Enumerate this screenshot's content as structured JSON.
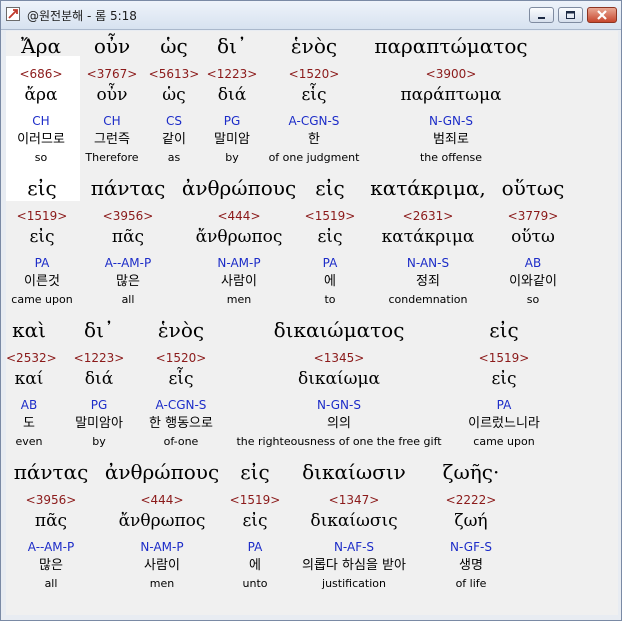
{
  "window": {
    "title": "@원전분해 - 롬 5:18"
  },
  "colors": {
    "strong_number": "#8b1a1a",
    "parsing": "#1c2cc8",
    "text": "#000000",
    "background": "#f0f0f0"
  },
  "rows": [
    {
      "words": [
        {
          "greek": "Ἄρα",
          "strong": "<686>",
          "lemma": "ἄρα",
          "parsing": "CH",
          "korean": "이러므로",
          "english": "so"
        },
        {
          "greek": "οὖν",
          "strong": "<3767>",
          "lemma": "οὖν",
          "parsing": "CH",
          "korean": "그런즉",
          "english": "Therefore"
        },
        {
          "greek": "ὡς",
          "strong": "<5613>",
          "lemma": "ὡς",
          "parsing": "CS",
          "korean": "같이",
          "english": "as"
        },
        {
          "greek": "δι᾽",
          "strong": "<1223>",
          "lemma": "διά",
          "parsing": "PG",
          "korean": "말미암",
          "english": "by"
        },
        {
          "greek": "ἑνὸς",
          "strong": "<1520>",
          "lemma": "εἷς",
          "parsing": "A-CGN-S",
          "korean": "한",
          "english": "of one judgment"
        },
        {
          "greek": "παραπτώματος",
          "strong": "<3900>",
          "lemma": "παράπτωμα",
          "parsing": "N-GN-S",
          "korean": "범죄로",
          "english": "the offense"
        }
      ]
    },
    {
      "words": [
        {
          "greek": "εἰς",
          "strong": "<1519>",
          "lemma": "εἰς",
          "parsing": "PA",
          "korean": "이른것",
          "english": "came upon"
        },
        {
          "greek": "πάντας",
          "strong": "<3956>",
          "lemma": "πᾶς",
          "parsing": "A--AM-P",
          "korean": "많은",
          "english": "all"
        },
        {
          "greek": "ἀνθρώπους",
          "strong": "<444>",
          "lemma": "ἄνθρωπος",
          "parsing": "N-AM-P",
          "korean": "사람이",
          "english": "men"
        },
        {
          "greek": "εἰς",
          "strong": "<1519>",
          "lemma": "εἰς",
          "parsing": "PA",
          "korean": "에",
          "english": "to"
        },
        {
          "greek": "κατάκριμα,",
          "strong": "<2631>",
          "lemma": "κατάκριμα",
          "parsing": "N-AN-S",
          "korean": "정죄",
          "english": "condemnation"
        },
        {
          "greek": "οὕτως",
          "strong": "<3779>",
          "lemma": "οὕτω",
          "parsing": "AB",
          "korean": "이와같이",
          "english": "so"
        }
      ]
    },
    {
      "words": [
        {
          "greek": "καὶ",
          "strong": "<2532>",
          "lemma": "καί",
          "parsing": "AB",
          "korean": "도",
          "english": "even"
        },
        {
          "greek": "δι᾽",
          "strong": "<1223>",
          "lemma": "διά",
          "parsing": "PG",
          "korean": "말미암아",
          "english": "by"
        },
        {
          "greek": "ἑνὸς",
          "strong": "<1520>",
          "lemma": "εἷς",
          "parsing": "A-CGN-S",
          "korean": "한 행동으로",
          "english": "of-one"
        },
        {
          "greek": "δικαιώματος",
          "strong": "<1345>",
          "lemma": "δικαίωμα",
          "parsing": "N-GN-S",
          "korean": "의의",
          "english": "the righteousness of one the free gift"
        },
        {
          "greek": "εἰς",
          "strong": "<1519>",
          "lemma": "εἰς",
          "parsing": "PA",
          "korean": "이르렀느니라",
          "english": "came upon"
        }
      ]
    },
    {
      "words": [
        {
          "greek": "πάντας",
          "strong": "<3956>",
          "lemma": "πᾶς",
          "parsing": "A--AM-P",
          "korean": "많은",
          "english": "all"
        },
        {
          "greek": "ἀνθρώπους",
          "strong": "<444>",
          "lemma": "ἄνθρωπος",
          "parsing": "N-AM-P",
          "korean": "사람이",
          "english": "men"
        },
        {
          "greek": "εἰς",
          "strong": "<1519>",
          "lemma": "εἰς",
          "parsing": "PA",
          "korean": "에",
          "english": "unto"
        },
        {
          "greek": "δικαίωσιν",
          "strong": "<1347>",
          "lemma": "δικαίωσις",
          "parsing": "N-AF-S",
          "korean": "의롭다 하심을 받아",
          "english": "justification"
        },
        {
          "greek": "ζωῆς·",
          "strong": "<2222>",
          "lemma": "ζωή",
          "parsing": "N-GF-S",
          "korean": "생명",
          "english": "of life"
        }
      ]
    }
  ]
}
